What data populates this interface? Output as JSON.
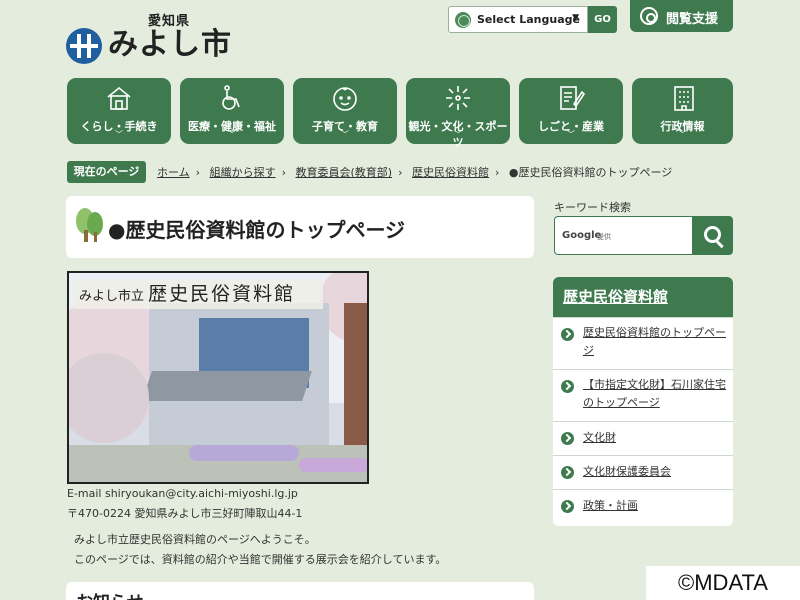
{
  "header": {
    "prefecture": "愛知県",
    "city": "みよし市",
    "language_label": "Select Language",
    "go_label": "GO",
    "assist_label": "閲覧支援"
  },
  "nav": [
    {
      "label": "くらし・手続き",
      "icon": "house-icon"
    },
    {
      "label": "医療・健康・福祉",
      "icon": "wheelchair-icon"
    },
    {
      "label": "子育て・教育",
      "icon": "baby-face-icon"
    },
    {
      "label": "観光・文化・スポーツ",
      "icon": "fireworks-icon"
    },
    {
      "label": "しごと・産業",
      "icon": "pen-paper-icon"
    },
    {
      "label": "行政情報",
      "icon": "building-icon"
    }
  ],
  "breadcrumb": {
    "tag": "現在のページ",
    "items": [
      "ホーム",
      "組織から探す",
      "教育委員会(教育部)",
      "歴史民俗資料館"
    ],
    "current": "●歴史民俗資料館のトップページ"
  },
  "main": {
    "title": "●歴史民俗資料館のトップページ",
    "photo_banner_small": "みよし市立",
    "photo_banner_big": "歴史民俗資料館",
    "email": "E-mail shiryoukan@city.aichi-miyoshi.lg.jp",
    "address": "〒470-0224 愛知県みよし市三好町陣取山44-1",
    "welcome": "みよし市立歴史民俗資料館のページへようこそ。",
    "intro": "このページでは、資料館の紹介や当館で開催する展示会を紹介しています。",
    "news_heading": "お知らせ"
  },
  "sidebar": {
    "keyword_label": "キーワード検索",
    "search_brand": "Google",
    "search_provided": "提供",
    "section_title": "歴史民俗資料館",
    "items": [
      "歴史民俗資料館のトップページ",
      "【市指定文化財】石川家住宅のトップページ",
      "文化財",
      "文化財保護委員会",
      "政策・計画"
    ]
  },
  "watermark": "©MDATA",
  "colors": {
    "primary": "#3f7a4f",
    "background": "#e4eddd",
    "logo": "#1f5fa0"
  }
}
